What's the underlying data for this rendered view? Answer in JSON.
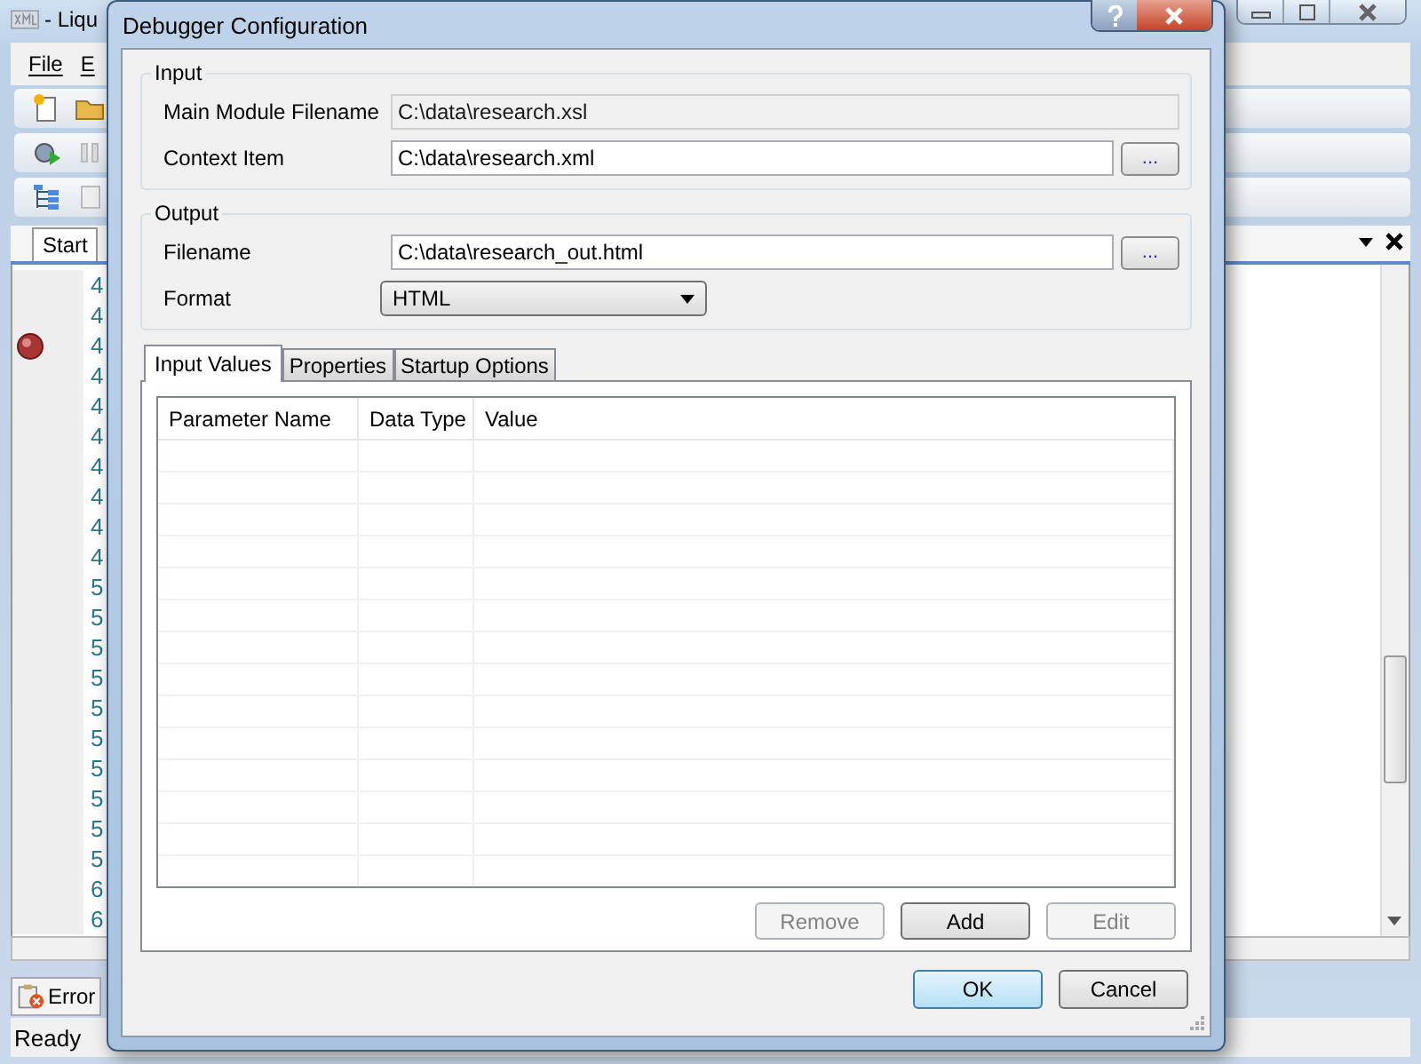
{
  "app_window": {
    "title": "- Liqu",
    "menu": [
      "File",
      "E"
    ],
    "editor_tab": "Start",
    "lines": [
      {
        "number": "4",
        "breakpoint": false
      },
      {
        "number": "4",
        "breakpoint": false
      },
      {
        "number": "4",
        "breakpoint": true
      },
      {
        "number": "4",
        "breakpoint": false
      },
      {
        "number": "4",
        "breakpoint": false
      },
      {
        "number": "4",
        "breakpoint": false
      },
      {
        "number": "4",
        "breakpoint": false
      },
      {
        "number": "4",
        "breakpoint": false
      },
      {
        "number": "4",
        "breakpoint": false
      },
      {
        "number": "4",
        "breakpoint": false
      },
      {
        "number": "5",
        "breakpoint": false
      },
      {
        "number": "5",
        "breakpoint": false
      },
      {
        "number": "5",
        "breakpoint": false
      },
      {
        "number": "5",
        "breakpoint": false
      },
      {
        "number": "5",
        "breakpoint": false
      },
      {
        "number": "5",
        "breakpoint": false
      },
      {
        "number": "5",
        "breakpoint": false
      },
      {
        "number": "5",
        "breakpoint": false
      },
      {
        "number": "5",
        "breakpoint": false
      },
      {
        "number": "5",
        "breakpoint": false
      },
      {
        "number": "6",
        "breakpoint": false
      },
      {
        "number": "6",
        "breakpoint": false
      }
    ],
    "error_tab": "Error",
    "status": "Ready"
  },
  "dialog": {
    "title": "Debugger Configuration",
    "groups": [
      {
        "legend": "Input",
        "fields": [
          {
            "label": "Main Module Filename",
            "kind": "text",
            "value": "C:\\data\\research.xsl",
            "readonly": true
          },
          {
            "label": "Context Item",
            "kind": "text",
            "value": "C:\\data\\research.xml",
            "readonly": false,
            "browse": "..."
          }
        ]
      },
      {
        "legend": "Output",
        "fields": [
          {
            "label": "Filename",
            "kind": "text",
            "value": "C:\\data\\research_out.html",
            "readonly": false,
            "browse": "..."
          },
          {
            "label": "Format",
            "kind": "dropdown",
            "value": "HTML"
          }
        ]
      }
    ],
    "tabs": [
      {
        "label": "Input Values",
        "selected": true
      },
      {
        "label": "Properties",
        "selected": false
      },
      {
        "label": "Startup Options",
        "selected": false
      }
    ],
    "table": {
      "columns": [
        "Parameter Name",
        "Data Type",
        "Value"
      ]
    },
    "table_buttons": [
      {
        "label": "Remove",
        "disabled": true
      },
      {
        "label": "Add",
        "disabled": false
      },
      {
        "label": "Edit",
        "disabled": true
      }
    ],
    "buttons": [
      {
        "label": "OK",
        "default": true
      },
      {
        "label": "Cancel",
        "default": false
      }
    ]
  }
}
